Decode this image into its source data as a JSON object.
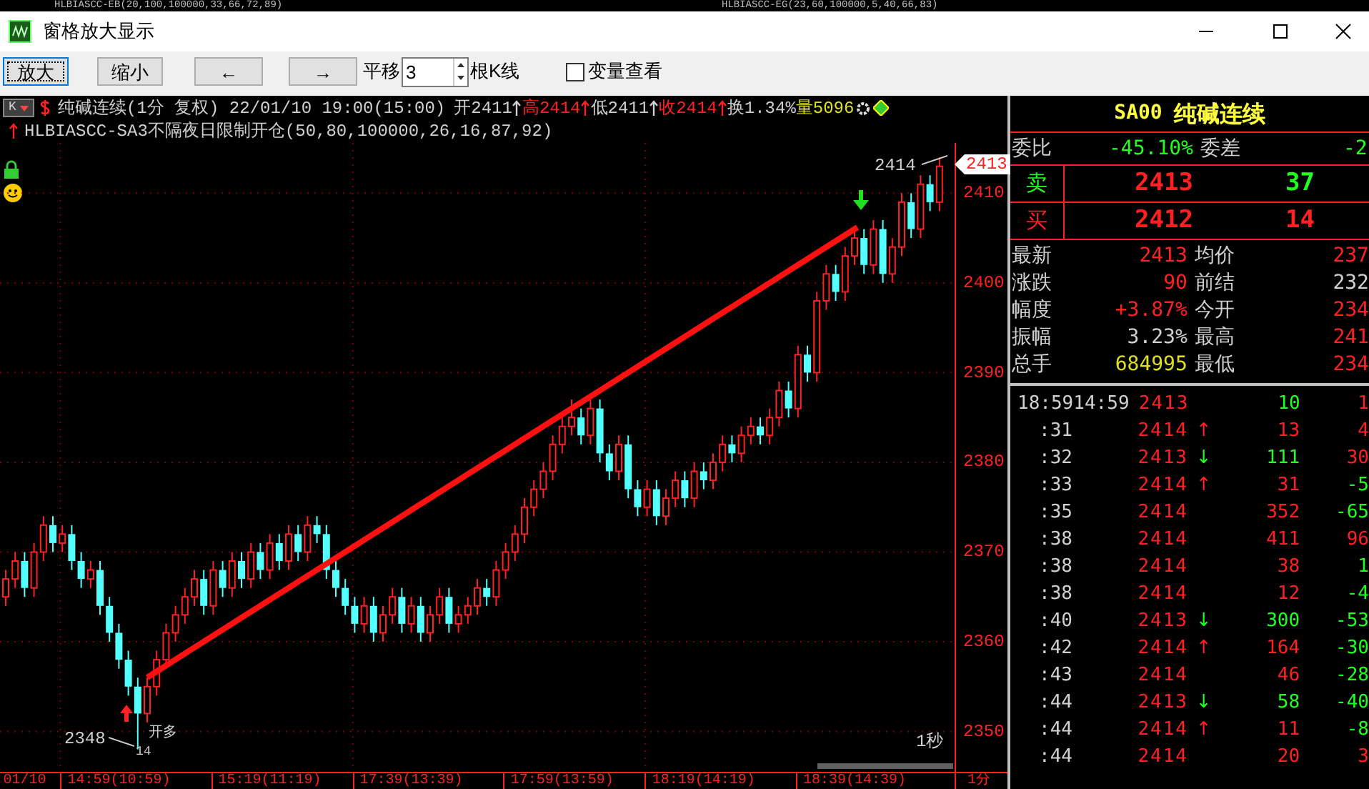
{
  "background_strip": [
    "HLBIASCC-EB(20,100,100000,33,66,72,89)",
    "HLBIASCC-EG(23,60,100000,5,40,66,83)"
  ],
  "window": {
    "title": "窗格放大显示"
  },
  "toolbar": {
    "buttons": [
      {
        "label": "放大",
        "focused": true
      },
      {
        "label": "缩小",
        "focused": false
      },
      {
        "label": "←",
        "focused": false
      },
      {
        "label": "→",
        "focused": false
      }
    ],
    "shift_label": "平移",
    "shift_value": "3",
    "shift_unit": "根K线",
    "checkbox": {
      "label": "变量查看",
      "checked": false
    }
  },
  "chart": {
    "period_button": "K",
    "title": "纯碱连续(1分 复权) 22/01/10 19:00(15:00)",
    "quotes": [
      {
        "text": "开2411",
        "color": "#d0d0d0",
        "arrow": true
      },
      {
        "text": "高2414",
        "color": "#ff2020",
        "arrow": true
      },
      {
        "text": "低2411",
        "color": "#d0d0d0",
        "arrow": true
      },
      {
        "text": "收2414",
        "color": "#ff2020",
        "arrow": true
      },
      {
        "text": "换1.34%",
        "color": "#d0d0d0",
        "arrow": false
      },
      {
        "text": "量5096",
        "color": "#e0e020",
        "arrow": false
      }
    ],
    "indicator": "HLBIASCC-SA3不隔夜日限制开仓(50,80,100000,26,16,87,92)",
    "chart_data": {
      "type": "candlestick",
      "grid": true,
      "ylim": [
        2345.5,
        2415.6
      ],
      "yticks": [
        {
          "value": 2410,
          "label": "2410"
        },
        {
          "value": 2400,
          "label": "2400"
        },
        {
          "value": 2390,
          "label": "2390"
        },
        {
          "value": 2380,
          "label": "2380"
        },
        {
          "value": 2370,
          "label": "2370"
        },
        {
          "value": 2360,
          "label": "2360"
        },
        {
          "value": 2350,
          "label": "2350"
        }
      ],
      "categories": [
        null,
        null,
        "01/10",
        null,
        null,
        null,
        null,
        null,
        null,
        null,
        null,
        null,
        "14:59(10:59)",
        null,
        null,
        null,
        null,
        null,
        null,
        null,
        null,
        null,
        null,
        null,
        null,
        null,
        null,
        null,
        "15:19(11:19)",
        null,
        null,
        null,
        null,
        null,
        null,
        null,
        null,
        null,
        null,
        null,
        null,
        null,
        null,
        "17:39(13:39)",
        null,
        null,
        null,
        null,
        null,
        null,
        null,
        null,
        null,
        null,
        null,
        null,
        null,
        null,
        null,
        "17:59(13:59)",
        null,
        null,
        null,
        null,
        null,
        null,
        null,
        null,
        null,
        null,
        null,
        null,
        null,
        null,
        "18:19(14:19)",
        null,
        null,
        null,
        null,
        null,
        null,
        null,
        null,
        null,
        null,
        null,
        null,
        null,
        null,
        null,
        "18:39(14:39)",
        null,
        null,
        null,
        null,
        null,
        null,
        null,
        null,
        null
      ],
      "ohlc": [
        [
          2365,
          2368,
          2364,
          2367
        ],
        [
          2367,
          2370,
          2366,
          2369
        ],
        [
          2369,
          2370,
          2365,
          2366
        ],
        [
          2366,
          2371,
          2365,
          2370
        ],
        [
          2370,
          2374,
          2369,
          2373
        ],
        [
          2373,
          2374,
          2370,
          2371
        ],
        [
          2371,
          2373,
          2370,
          2372
        ],
        [
          2372,
          2373,
          2368,
          2369
        ],
        [
          2369,
          2370,
          2366,
          2367
        ],
        [
          2367,
          2369,
          2366,
          2368
        ],
        [
          2368,
          2369,
          2363,
          2364
        ],
        [
          2364,
          2365,
          2360,
          2361
        ],
        [
          2361,
          2362,
          2357,
          2358
        ],
        [
          2358,
          2359,
          2354,
          2355
        ],
        [
          2355,
          2356,
          2348,
          2352
        ],
        [
          2352,
          2356,
          2351,
          2355
        ],
        [
          2355,
          2359,
          2354,
          2358
        ],
        [
          2358,
          2362,
          2357,
          2361
        ],
        [
          2361,
          2364,
          2360,
          2363
        ],
        [
          2363,
          2366,
          2362,
          2365
        ],
        [
          2365,
          2368,
          2364,
          2367
        ],
        [
          2367,
          2368,
          2363,
          2364
        ],
        [
          2364,
          2369,
          2363,
          2368
        ],
        [
          2368,
          2369,
          2365,
          2366
        ],
        [
          2366,
          2370,
          2365,
          2369
        ],
        [
          2369,
          2370,
          2366,
          2367
        ],
        [
          2367,
          2371,
          2366,
          2370
        ],
        [
          2370,
          2371,
          2367,
          2368
        ],
        [
          2368,
          2372,
          2367,
          2371
        ],
        [
          2371,
          2372,
          2368,
          2369
        ],
        [
          2369,
          2373,
          2368,
          2372
        ],
        [
          2372,
          2373,
          2369,
          2370
        ],
        [
          2370,
          2374,
          2369,
          2373
        ],
        [
          2373,
          2374,
          2371,
          2372
        ],
        [
          2372,
          2373,
          2367,
          2368
        ],
        [
          2368,
          2369,
          2365,
          2366
        ],
        [
          2366,
          2367,
          2363,
          2364
        ],
        [
          2364,
          2365,
          2361,
          2362
        ],
        [
          2362,
          2365,
          2361,
          2364
        ],
        [
          2364,
          2365,
          2360,
          2361
        ],
        [
          2361,
          2364,
          2360,
          2363
        ],
        [
          2363,
          2366,
          2362,
          2365
        ],
        [
          2365,
          2366,
          2361,
          2362
        ],
        [
          2362,
          2365,
          2361,
          2364
        ],
        [
          2364,
          2365,
          2360,
          2361
        ],
        [
          2361,
          2364,
          2360,
          2363
        ],
        [
          2363,
          2366,
          2362,
          2365
        ],
        [
          2365,
          2366,
          2361,
          2362
        ],
        [
          2362,
          2364,
          2361,
          2363
        ],
        [
          2363,
          2365,
          2362,
          2364
        ],
        [
          2364,
          2367,
          2363,
          2366
        ],
        [
          2366,
          2367,
          2364,
          2365
        ],
        [
          2365,
          2369,
          2364,
          2368
        ],
        [
          2368,
          2371,
          2367,
          2370
        ],
        [
          2370,
          2373,
          2369,
          2372
        ],
        [
          2372,
          2376,
          2371,
          2375
        ],
        [
          2375,
          2378,
          2374,
          2377
        ],
        [
          2377,
          2380,
          2376,
          2379
        ],
        [
          2379,
          2383,
          2378,
          2382
        ],
        [
          2382,
          2385,
          2381,
          2384
        ],
        [
          2384,
          2387,
          2383,
          2385
        ],
        [
          2385,
          2386,
          2382,
          2383
        ],
        [
          2383,
          2387,
          2382,
          2386
        ],
        [
          2386,
          2387,
          2380,
          2381
        ],
        [
          2381,
          2382,
          2378,
          2379
        ],
        [
          2379,
          2383,
          2378,
          2382
        ],
        [
          2382,
          2383,
          2376,
          2377
        ],
        [
          2377,
          2378,
          2374,
          2375
        ],
        [
          2375,
          2378,
          2374,
          2377
        ],
        [
          2377,
          2378,
          2373,
          2374
        ],
        [
          2374,
          2377,
          2373,
          2376
        ],
        [
          2376,
          2379,
          2375,
          2378
        ],
        [
          2378,
          2379,
          2375,
          2376
        ],
        [
          2376,
          2380,
          2375,
          2379
        ],
        [
          2379,
          2380,
          2377,
          2378
        ],
        [
          2378,
          2381,
          2377,
          2380
        ],
        [
          2380,
          2383,
          2379,
          2382
        ],
        [
          2382,
          2383,
          2380,
          2381
        ],
        [
          2381,
          2384,
          2380,
          2383
        ],
        [
          2383,
          2385,
          2382,
          2384
        ],
        [
          2384,
          2385,
          2382,
          2383
        ],
        [
          2383,
          2386,
          2382,
          2385
        ],
        [
          2385,
          2389,
          2384,
          2388
        ],
        [
          2388,
          2389,
          2385,
          2386
        ],
        [
          2386,
          2393,
          2385,
          2392
        ],
        [
          2392,
          2393,
          2389,
          2390
        ],
        [
          2390,
          2399,
          2389,
          2398
        ],
        [
          2398,
          2402,
          2397,
          2401
        ],
        [
          2401,
          2402,
          2398,
          2399
        ],
        [
          2399,
          2404,
          2398,
          2403
        ],
        [
          2403,
          2406,
          2402,
          2405
        ],
        [
          2405,
          2406,
          2401,
          2402
        ],
        [
          2402,
          2407,
          2401,
          2406
        ],
        [
          2406,
          2407,
          2400,
          2401
        ],
        [
          2401,
          2405,
          2400,
          2404
        ],
        [
          2404,
          2410,
          2403,
          2409
        ],
        [
          2409,
          2410,
          2405,
          2406
        ],
        [
          2406,
          2412,
          2405,
          2411
        ],
        [
          2411,
          2412,
          2408,
          2409
        ],
        [
          2409,
          2414,
          2408,
          2413
        ]
      ]
    },
    "last_price": "2413",
    "high_label": "2414",
    "low_label": "2348",
    "low_signal": "开多",
    "low_count": "14",
    "interval": "1秒",
    "period": "1分"
  },
  "quote_panel": {
    "title": "SA00",
    "name": "纯碱连续",
    "ratio": {
      "label": "委比",
      "value": "-45.10%",
      "diff_label": "委差",
      "diff_value": "-2"
    },
    "sell": {
      "label": "卖",
      "price": "2413",
      "volume": "37"
    },
    "buy": {
      "label": "买",
      "price": "2412",
      "volume": "14"
    },
    "stats": [
      {
        "left": {
          "label": "最新",
          "value": "2413",
          "color": "#ff2020"
        },
        "right": {
          "label": "均价",
          "value": "237",
          "color": "#ff2020"
        }
      },
      {
        "left": {
          "label": "涨跌",
          "value": "90",
          "color": "#ff2020"
        },
        "right": {
          "label": "前结",
          "value": "232",
          "color": "#d0d0d0"
        }
      },
      {
        "left": {
          "label": "幅度",
          "value": "+3.87%",
          "color": "#ff2020"
        },
        "right": {
          "label": "今开",
          "value": "234",
          "color": "#ff2020"
        }
      },
      {
        "left": {
          "label": "振幅",
          "value": "3.23%",
          "color": "#d0d0d0"
        },
        "right": {
          "label": "最高",
          "value": "241",
          "color": "#ff2020"
        }
      },
      {
        "left": {
          "label": "总手",
          "value": "684995",
          "color": "#e0e020"
        },
        "right": {
          "label": "最低",
          "value": "234",
          "color": "#ff2020"
        }
      }
    ]
  },
  "trades": [
    {
      "time": "18:59",
      "time2": "14:59",
      "price": "2413",
      "volume": "10",
      "volume_up": false,
      "change": "1",
      "change_up": true
    },
    {
      "time": ":31",
      "price": "2414",
      "arrow": "↑",
      "volume": "13",
      "volume_up": true,
      "change": "4",
      "change_up": true
    },
    {
      "time": ":32",
      "price": "2413",
      "arrow": "↓",
      "volume": "111",
      "volume_up": false,
      "change": "30",
      "change_up": true
    },
    {
      "time": ":33",
      "price": "2414",
      "arrow": "↑",
      "volume": "31",
      "volume_up": true,
      "change": "-5",
      "change_up": false
    },
    {
      "time": ":35",
      "price": "2414",
      "volume": "352",
      "volume_up": true,
      "change": "-65",
      "change_up": false
    },
    {
      "time": ":38",
      "price": "2414",
      "volume": "411",
      "volume_up": true,
      "change": "96",
      "change_up": true
    },
    {
      "time": ":38",
      "price": "2414",
      "volume": "38",
      "volume_up": true,
      "change": "1",
      "change_up": false
    },
    {
      "time": ":38",
      "price": "2414",
      "volume": "12",
      "volume_up": true,
      "change": "-4",
      "change_up": false
    },
    {
      "time": ":40",
      "price": "2413",
      "arrow": "↓",
      "volume": "300",
      "volume_up": false,
      "change": "-53",
      "change_up": false
    },
    {
      "time": ":42",
      "price": "2414",
      "arrow": "↑",
      "volume": "164",
      "volume_up": true,
      "change": "-30",
      "change_up": false
    },
    {
      "time": ":43",
      "price": "2414",
      "volume": "46",
      "volume_up": true,
      "change": "-28",
      "change_up": false
    },
    {
      "time": ":44",
      "price": "2413",
      "arrow": "↓",
      "volume": "58",
      "volume_up": false,
      "change": "-40",
      "change_up": false
    },
    {
      "time": ":44",
      "price": "2414",
      "arrow": "↑",
      "volume": "11",
      "volume_up": true,
      "change": "-8",
      "change_up": false
    },
    {
      "time": ":44",
      "price": "2414",
      "volume": "20",
      "volume_up": true,
      "change": "3",
      "change_up": true
    }
  ]
}
